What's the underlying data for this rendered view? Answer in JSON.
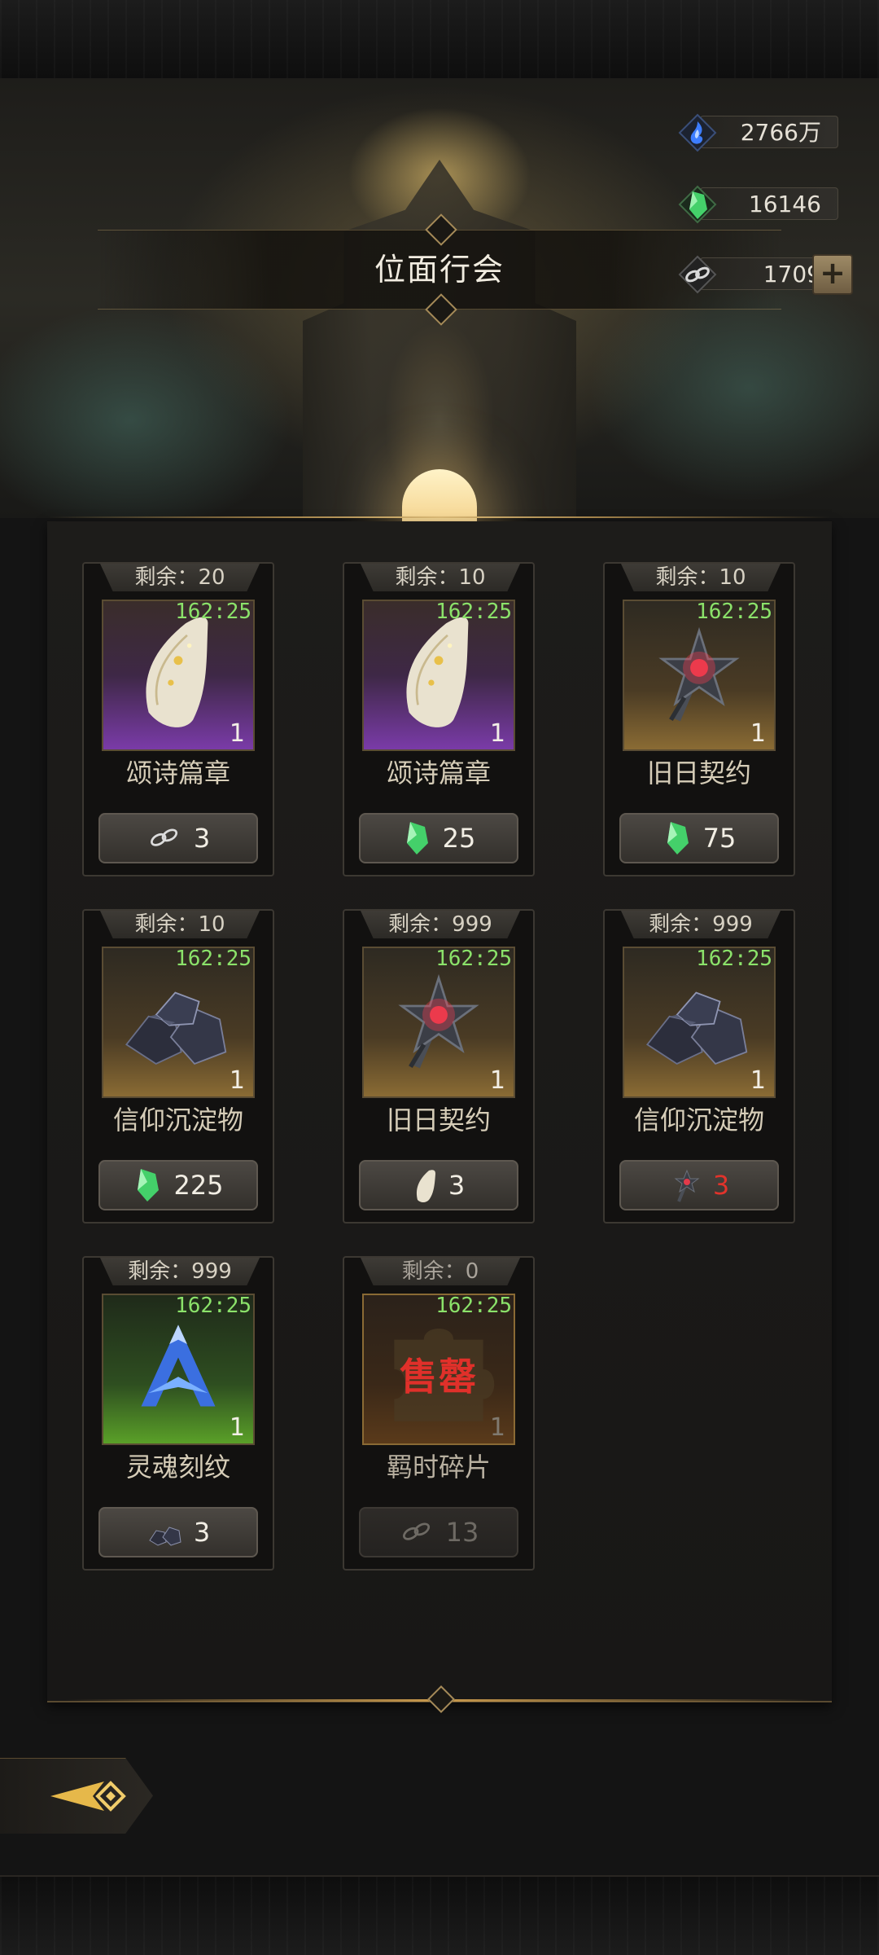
{
  "header": {
    "title": "位面行会"
  },
  "currencies": [
    {
      "name": "soul-flame",
      "value": "2766万",
      "color": "#3d7dff"
    },
    {
      "name": "green-crystal",
      "value": "16146",
      "color": "#44d06a"
    },
    {
      "name": "chain-link",
      "value": "1709",
      "color": "#cfcfcf"
    }
  ],
  "shop": {
    "items": [
      {
        "remain": "剩余：20",
        "timer": "162:25",
        "qty": "1",
        "name": "颂诗篇章",
        "price": "3",
        "cost_icon": "chain-link-icon",
        "bg": "purple",
        "icon": "scroll-icon"
      },
      {
        "remain": "剩余：10",
        "timer": "162:25",
        "qty": "1",
        "name": "颂诗篇章",
        "price": "25",
        "cost_icon": "green-crystal-icon",
        "bg": "purple",
        "icon": "scroll-icon"
      },
      {
        "remain": "剩余：10",
        "timer": "162:25",
        "qty": "1",
        "name": "旧日契约",
        "price": "75",
        "cost_icon": "green-crystal-icon",
        "bg": "gold",
        "icon": "star-staff-icon"
      },
      {
        "remain": "剩余：10",
        "timer": "162:25",
        "qty": "1",
        "name": "信仰沉淀物",
        "price": "225",
        "cost_icon": "green-crystal-icon",
        "bg": "gold",
        "icon": "ore-pile-icon"
      },
      {
        "remain": "剩余：999",
        "timer": "162:25",
        "qty": "1",
        "name": "旧日契约",
        "price": "3",
        "cost_icon": "scroll-icon",
        "bg": "gold",
        "icon": "star-staff-icon"
      },
      {
        "remain": "剩余：999",
        "timer": "162:25",
        "qty": "1",
        "name": "信仰沉淀物",
        "price": "3",
        "cost_icon": "star-staff-icon",
        "bg": "gold",
        "icon": "ore-pile-icon",
        "price_color": "#e1332b"
      },
      {
        "remain": "剩余：999",
        "timer": "162:25",
        "qty": "1",
        "name": "灵魂刻纹",
        "price": "3",
        "cost_icon": "ore-pile-icon",
        "bg": "green",
        "icon": "soul-rune-icon"
      },
      {
        "remain": "剩余：0",
        "timer": "162:25",
        "qty": "1",
        "name": "羁时碎片",
        "price": "13",
        "cost_icon": "chain-link-icon",
        "bg": "sold",
        "icon": "puzzle-piece-icon",
        "sold_label": "售罄"
      }
    ]
  },
  "colors": {
    "timer": "#8be26a",
    "accent_gold": "#c99a4d",
    "sold_red": "#e0302a"
  }
}
